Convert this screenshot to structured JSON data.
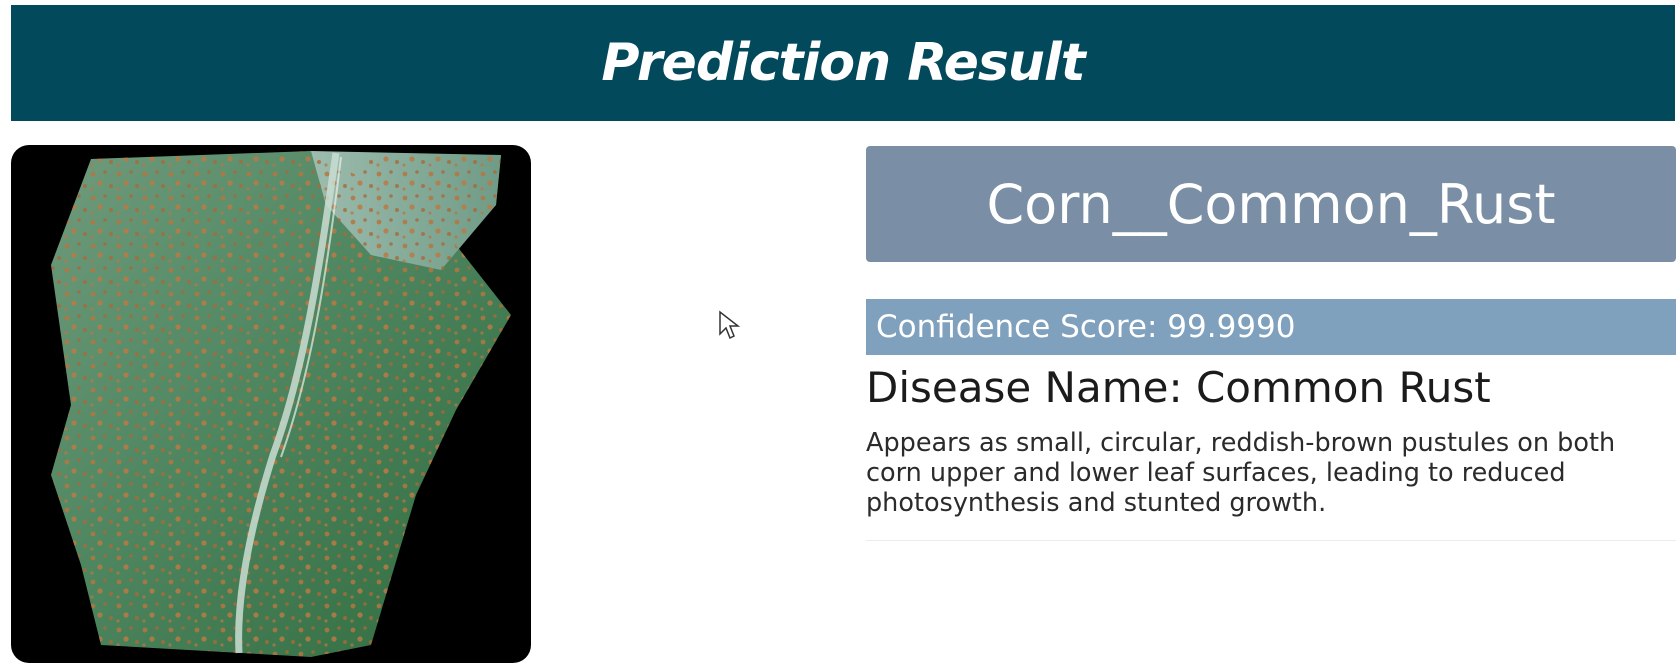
{
  "header": {
    "title": "Prediction Result"
  },
  "image": {
    "subject": "corn-leaf-with-rust-pustules"
  },
  "result": {
    "predicted_class": "Corn__Common_Rust",
    "confidence_text": "Confidence Score: 99.9990",
    "disease_name_text": "Disease Name: Common Rust",
    "description": "Appears as small, circular, reddish-brown pustules on both corn upper and lower leaf surfaces, leading to reduced photosynthesis and stunted growth."
  },
  "colors": {
    "header_bg": "#02495b",
    "class_box_bg": "#7a8fa6",
    "confidence_bar_bg": "#7fa1be"
  }
}
